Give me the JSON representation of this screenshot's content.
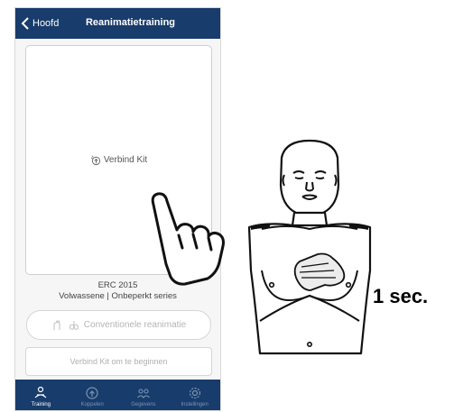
{
  "header": {
    "back_label": "Hoofd",
    "title": "Reanimatietraining"
  },
  "panel": {
    "connect_label": "Verbind Kit"
  },
  "protocol": {
    "line1": "ERC 2015",
    "line2": "Volwassene | Onbeperkt series"
  },
  "mode_button": {
    "label": "Conventionele reanimatie"
  },
  "start_button": {
    "label": "Verbind Kit om te beginnen"
  },
  "tabs": [
    {
      "label": "Training",
      "icon": "training-icon",
      "active": true
    },
    {
      "label": "Koppelen",
      "icon": "koppelen-icon",
      "active": false
    },
    {
      "label": "Gegevens",
      "icon": "gegevens-icon",
      "active": false
    },
    {
      "label": "Instellingen",
      "icon": "gear-icon",
      "active": false
    }
  ],
  "instruction": {
    "duration": "1 sec."
  },
  "colors": {
    "header_bg": "#183c6b",
    "panel_border": "#cfcfcf",
    "inactive_text": "#b0b0b0"
  }
}
